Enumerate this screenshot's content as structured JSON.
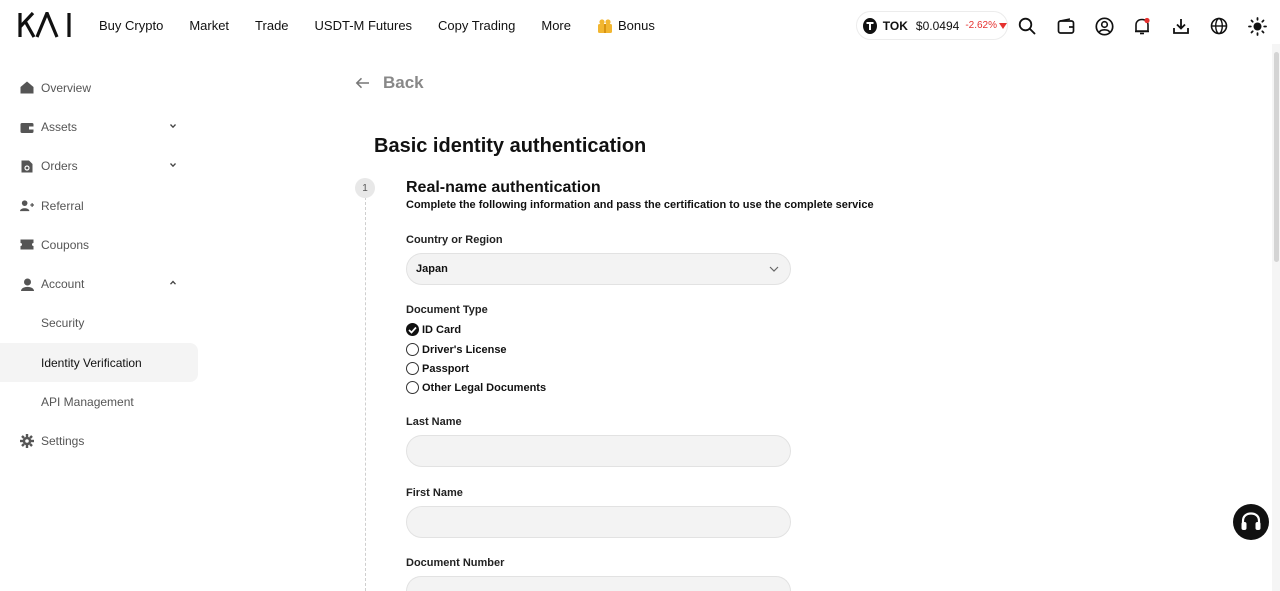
{
  "header": {
    "logo_text": "KAI",
    "nav": [
      {
        "label": "Buy Crypto"
      },
      {
        "label": "Market"
      },
      {
        "label": "Trade"
      },
      {
        "label": "USDT-M Futures"
      },
      {
        "label": "Copy Trading"
      },
      {
        "label": "More"
      },
      {
        "label": "Bonus",
        "icon": "gift-icon"
      }
    ],
    "ticker": {
      "symbol": "TOK",
      "price": "$0.0494",
      "change": "-2.62%",
      "change_color": "#e5312f"
    },
    "icons": [
      "search-icon",
      "wallet-icon",
      "user-icon",
      "bell-icon",
      "download-icon",
      "globe-icon",
      "theme-sun-icon"
    ]
  },
  "sidebar": {
    "items": [
      {
        "label": "Overview",
        "icon": "home-icon"
      },
      {
        "label": "Assets",
        "icon": "assets-icon",
        "expand": "collapsed"
      },
      {
        "label": "Orders",
        "icon": "orders-icon",
        "expand": "collapsed"
      },
      {
        "label": "Referral",
        "icon": "referral-icon"
      },
      {
        "label": "Coupons",
        "icon": "coupon-icon"
      },
      {
        "label": "Account",
        "icon": "account-icon",
        "expand": "expanded"
      },
      {
        "label": "Settings",
        "icon": "settings-icon"
      }
    ],
    "account_subitems": [
      {
        "label": "Security"
      },
      {
        "label": "Identity Verification",
        "active": true
      },
      {
        "label": "API Management"
      }
    ]
  },
  "main": {
    "back_label": "Back",
    "title": "Basic identity authentication",
    "step": {
      "number": "1",
      "title": "Real-name authentication",
      "description": "Complete the following information and pass the certification to use the complete service"
    },
    "country": {
      "label": "Country or Region",
      "value": "Japan"
    },
    "document_type": {
      "label": "Document Type",
      "options": [
        {
          "label": "ID Card",
          "checked": true
        },
        {
          "label": "Driver's License",
          "checked": false
        },
        {
          "label": "Passport",
          "checked": false
        },
        {
          "label": "Other Legal Documents",
          "checked": false
        }
      ]
    },
    "fields": {
      "last_name": {
        "label": "Last Name",
        "value": ""
      },
      "first_name": {
        "label": "First Name",
        "value": ""
      },
      "document_number": {
        "label": "Document Number",
        "value": ""
      }
    }
  },
  "colors": {
    "accent": "#111111",
    "down": "#e5312f",
    "input_bg": "#f3f3f3"
  }
}
